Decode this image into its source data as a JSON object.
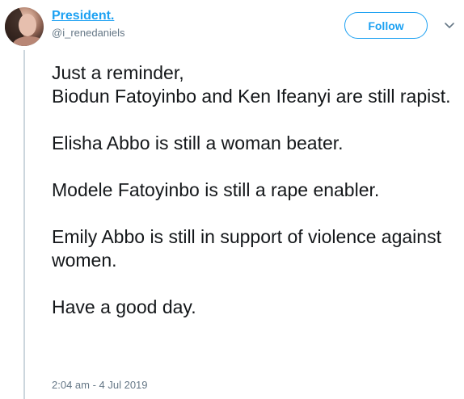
{
  "author": {
    "display_name": "President.",
    "handle": "@i_renedaniels"
  },
  "actions": {
    "follow_label": "Follow",
    "caret_icon": "chevron-down-icon"
  },
  "tweet": {
    "paragraphs": [
      "Just a reminder,\nBiodun Fatoyinbo and Ken Ifeanyi are still rapist.",
      "Elisha Abbo is still a woman beater.",
      "Modele Fatoyinbo is still a rape enabler.",
      "Emily Abbo is still in support of violence against women.",
      "Have a good day."
    ],
    "timestamp": "2:04 am - 4 Jul 2019"
  },
  "colors": {
    "accent": "#1da1f2",
    "text": "#14171a",
    "muted": "#657786",
    "thread_line": "#ccd6dd"
  }
}
